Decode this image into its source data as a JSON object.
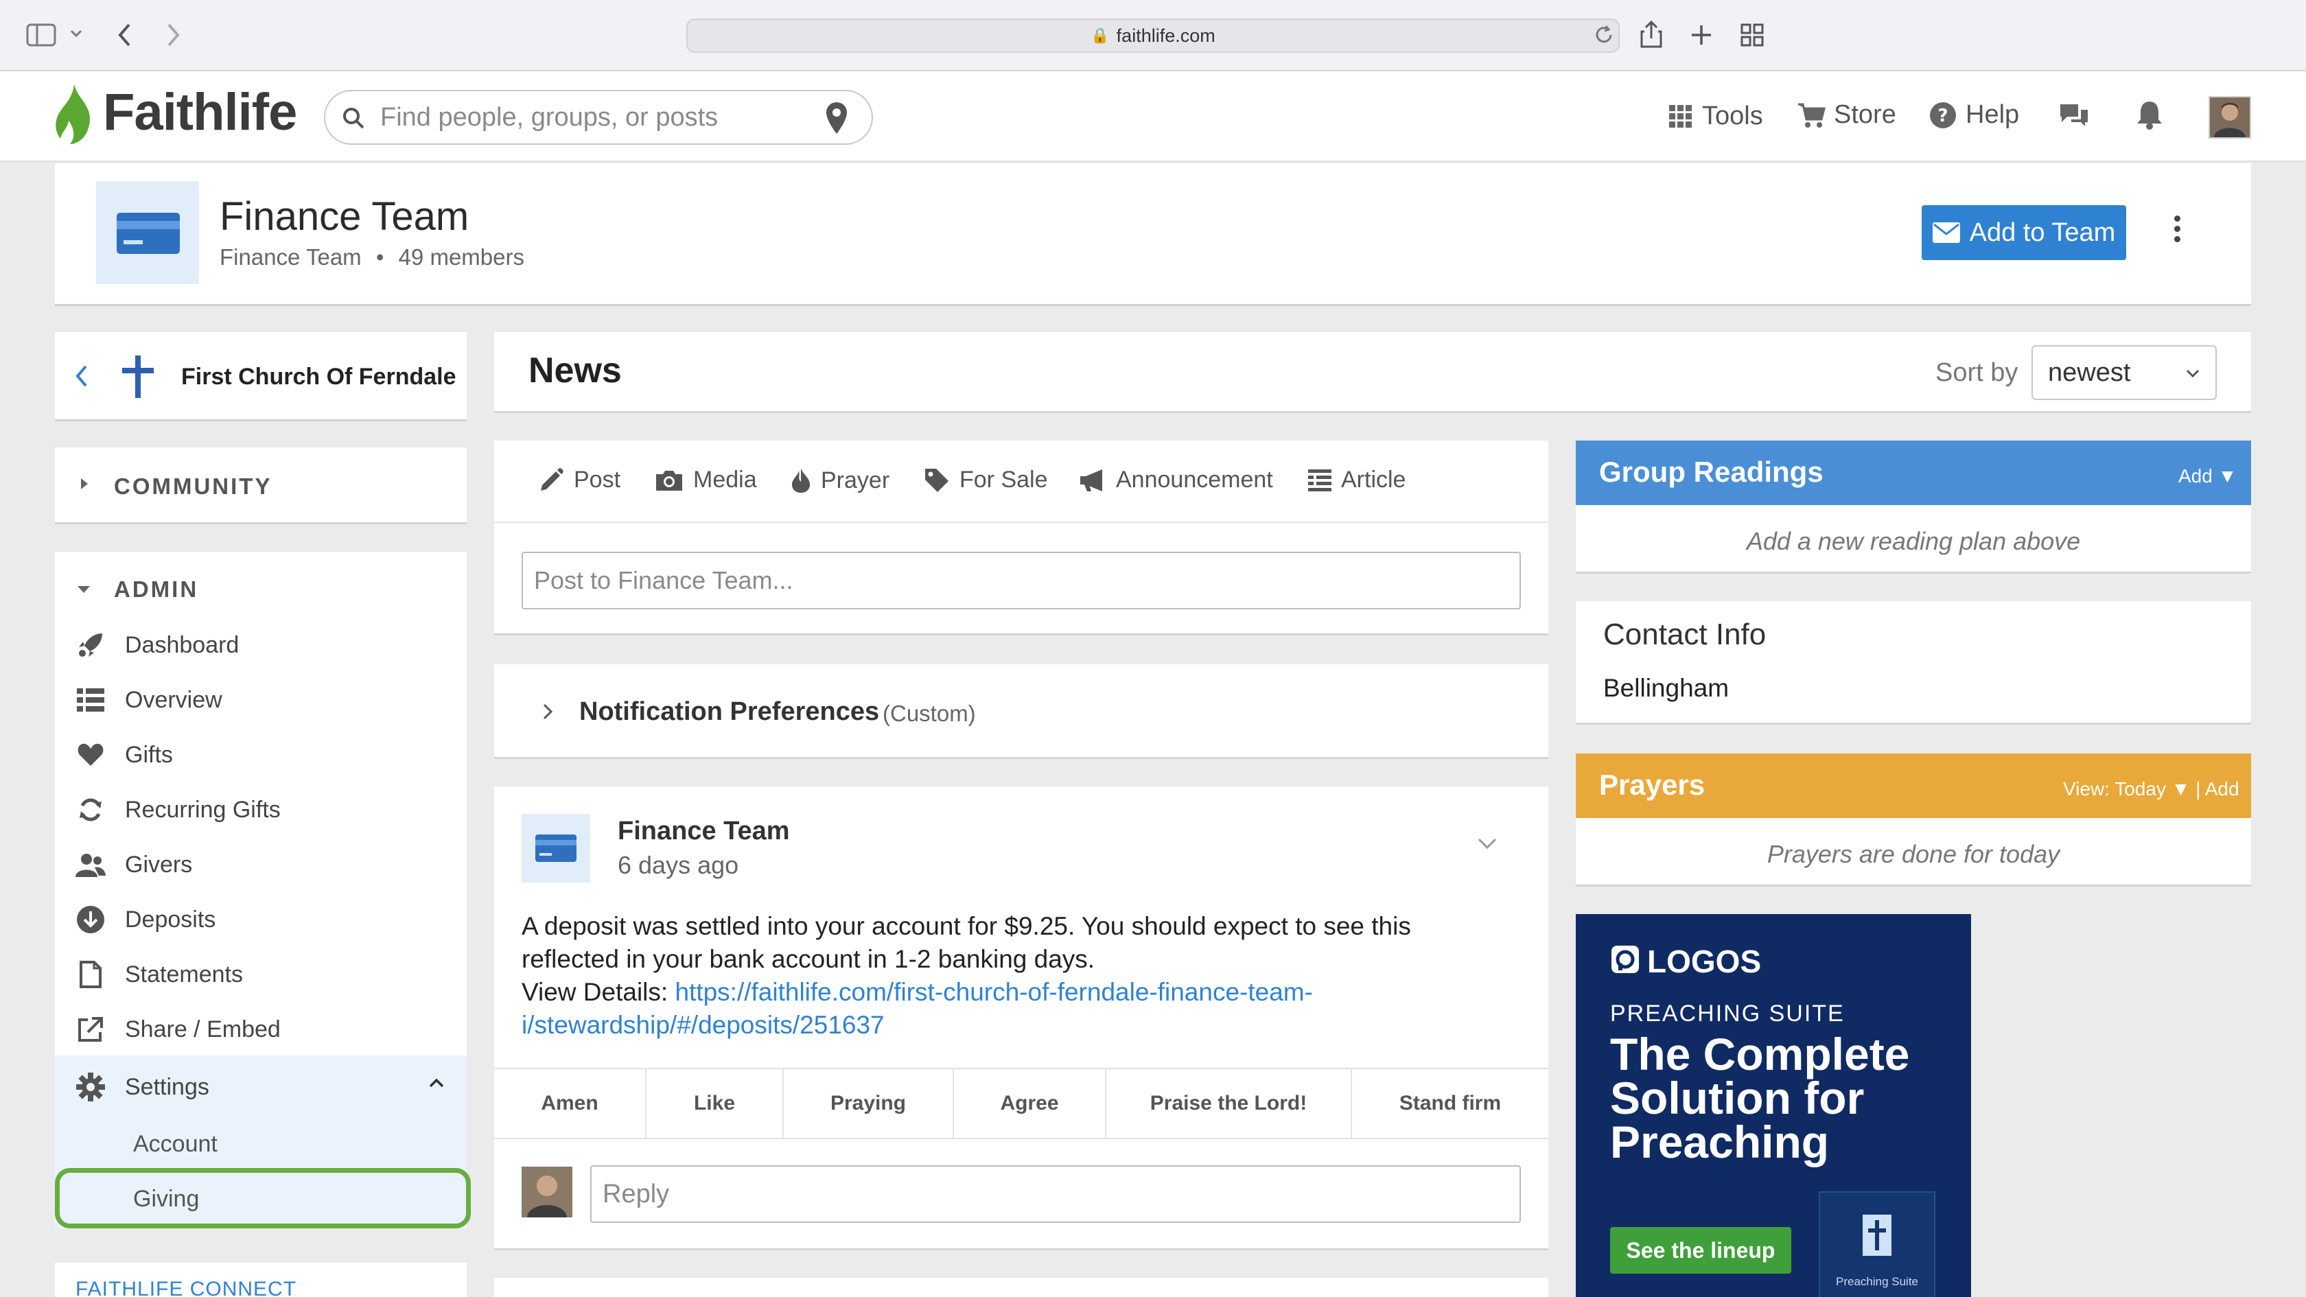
{
  "browser": {
    "url": "faithlife.com"
  },
  "navbar": {
    "logo": "Faithlife",
    "search_placeholder": "Find people, groups, or posts",
    "tools": "Tools",
    "store": "Store",
    "help": "Help"
  },
  "group": {
    "title": "Finance Team",
    "subtitle": "Finance Team",
    "members": "49 members",
    "add_button": "Add to Team"
  },
  "sidebar": {
    "church": "First Church Of Ferndale",
    "community": "COMMUNITY",
    "admin": "ADMIN",
    "items": [
      {
        "label": "Dashboard"
      },
      {
        "label": "Overview"
      },
      {
        "label": "Gifts"
      },
      {
        "label": "Recurring Gifts"
      },
      {
        "label": "Givers"
      },
      {
        "label": "Deposits"
      },
      {
        "label": "Statements"
      },
      {
        "label": "Share / Embed"
      }
    ],
    "settings": "Settings",
    "settings_sub": [
      "Account",
      "Giving"
    ],
    "connect": "FAITHLIFE CONNECT"
  },
  "news": {
    "title": "News",
    "sort_label": "Sort by",
    "sort_value": "newest"
  },
  "composer": {
    "types": [
      "Post",
      "Media",
      "Prayer",
      "For Sale",
      "Announcement",
      "Article"
    ],
    "placeholder": "Post to Finance Team..."
  },
  "notifications": {
    "title": "Notification Preferences",
    "mode": "(Custom)"
  },
  "post": {
    "author": "Finance Team",
    "time": "6 days ago",
    "body": "A deposit was settled into your account for $9.25. You should expect to see this reflected in your bank account in 1-2 banking days.",
    "details_label": "View Details:",
    "link": "https://faithlife.com/first-church-of-ferndale-finance-team-i/stewardship/#/deposits/251637",
    "reactions": [
      "Amen",
      "Like",
      "Praying",
      "Agree",
      "Praise the Lord!",
      "Stand firm"
    ],
    "reply_placeholder": "Reply"
  },
  "readings": {
    "title": "Group Readings",
    "add": "Add ▼",
    "empty": "Add a new reading plan above"
  },
  "contact": {
    "title": "Contact Info",
    "city": "Bellingham"
  },
  "prayers": {
    "title": "Prayers",
    "view": "View: Today ▼ | Add",
    "empty": "Prayers are done for today"
  },
  "ad": {
    "brand": "LOGOS",
    "kicker": "PREACHING SUITE",
    "headline": "The Complete Solution for Preaching",
    "cta": "See the lineup",
    "box_label": "Preaching Suite"
  },
  "colors": {
    "primary": "#2f82d2",
    "readings": "#4a8fd6",
    "prayers": "#e9a83a",
    "highlight": "#68ad3e",
    "logo_green": "#5aa832"
  }
}
